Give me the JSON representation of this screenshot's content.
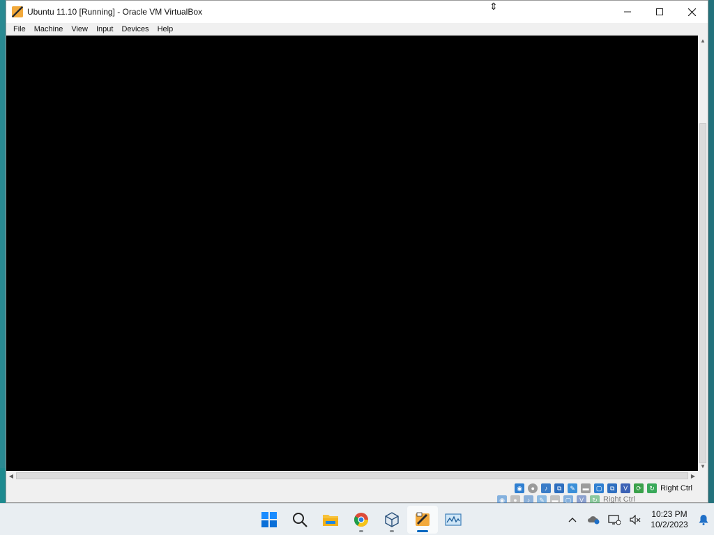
{
  "window": {
    "title": "Ubuntu 11.10 [Running] - Oracle VM VirtualBox"
  },
  "menu": {
    "items": [
      "File",
      "Machine",
      "View",
      "Input",
      "Devices",
      "Help"
    ]
  },
  "statusbar": {
    "host_key": "Right Ctrl"
  },
  "taskbar": {
    "apps": [
      "start-icon",
      "search-icon",
      "file-explorer-icon",
      "chrome-icon",
      "virtualbox-manager-icon",
      "virtualbox-vm-icon",
      "resource-monitor-icon"
    ]
  },
  "tray": {
    "time": "10:23 PM",
    "date": "10/2/2023"
  },
  "colors": {
    "vm_screen": "#000000",
    "accent": "#0067c0"
  }
}
